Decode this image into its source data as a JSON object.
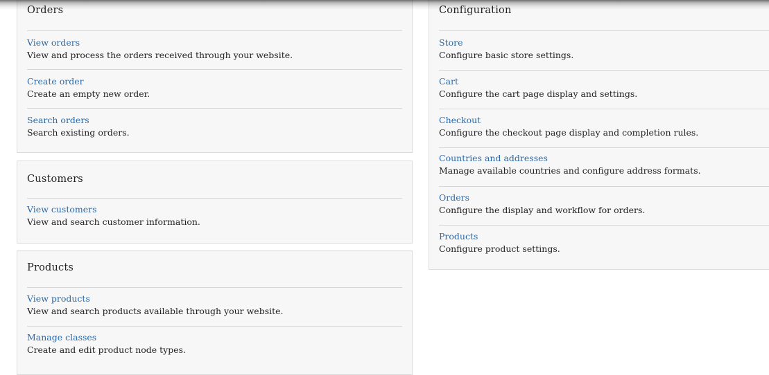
{
  "orders": {
    "title": "Orders",
    "items": [
      {
        "label": "View orders",
        "description": "View and process the orders received through your website."
      },
      {
        "label": "Create order",
        "description": "Create an empty new order."
      },
      {
        "label": "Search orders",
        "description": "Search existing orders."
      }
    ]
  },
  "customers": {
    "title": "Customers",
    "items": [
      {
        "label": "View customers",
        "description": "View and search customer information."
      }
    ]
  },
  "products": {
    "title": "Products",
    "items": [
      {
        "label": "View products",
        "description": "View and search products available through your website."
      },
      {
        "label": "Manage classes",
        "description": "Create and edit product node types."
      }
    ]
  },
  "configuration": {
    "title": "Configuration",
    "items": [
      {
        "label": "Store",
        "description": "Configure basic store settings."
      },
      {
        "label": "Cart",
        "description": "Configure the cart page display and settings."
      },
      {
        "label": "Checkout",
        "description": "Configure the checkout page display and completion rules."
      },
      {
        "label": "Countries and addresses",
        "description": "Manage available countries and configure address formats."
      },
      {
        "label": "Orders",
        "description": "Configure the display and workflow for orders."
      },
      {
        "label": "Products",
        "description": "Configure product settings."
      }
    ]
  }
}
